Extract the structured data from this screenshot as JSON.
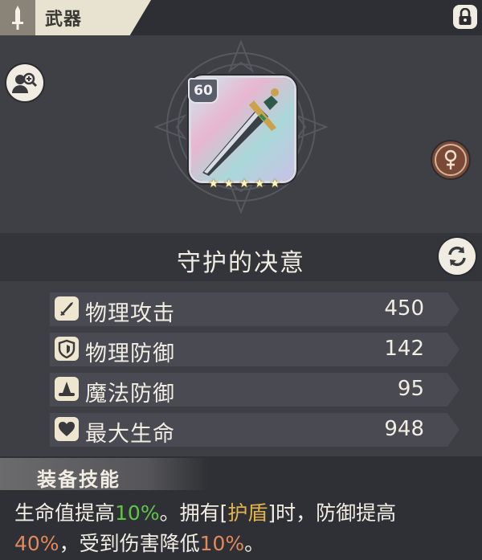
{
  "header": {
    "tab_title": "武器"
  },
  "item": {
    "level": "60",
    "stars": 5,
    "name": "守护的决意"
  },
  "stats": [
    {
      "icon": "sword-icon",
      "label": "物理攻击",
      "value": "450"
    },
    {
      "icon": "shield-icon",
      "label": "物理防御",
      "value": "142"
    },
    {
      "icon": "wizard-hat-icon",
      "label": "魔法防御",
      "value": "95"
    },
    {
      "icon": "heart-icon",
      "label": "最大生命",
      "value": "948"
    }
  ],
  "skill": {
    "title": "装备技能",
    "parts": {
      "p1": "生命值提高",
      "v1": "10%",
      "p2": "。拥有[",
      "kw": "护盾",
      "p3": "]时，防御提高",
      "v2": "40%",
      "p4": "，受到伤害降低",
      "v3": "10%",
      "p5": "。"
    }
  },
  "colors": {
    "green": "#5fc44a",
    "gold": "#e2b44a",
    "orange": "#e2885a"
  }
}
